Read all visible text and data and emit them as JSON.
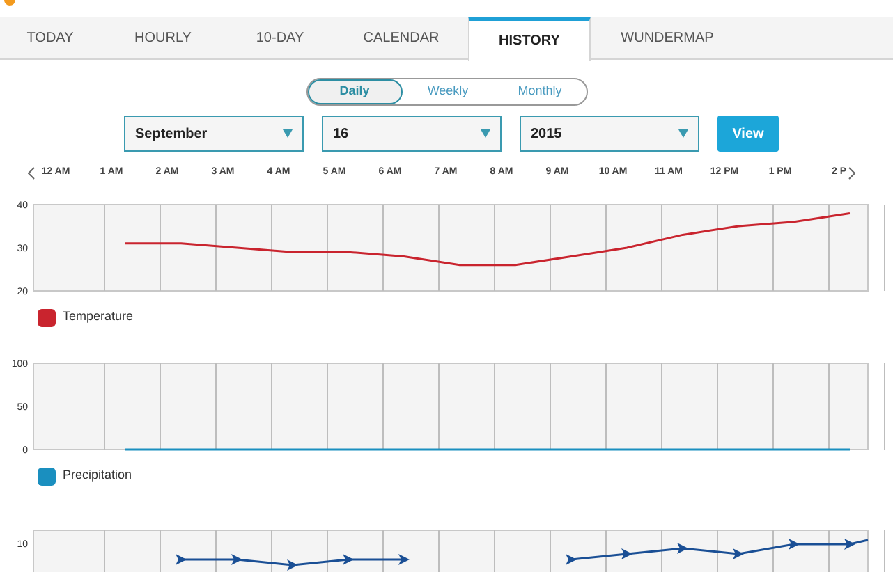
{
  "tabs": [
    {
      "label": "TODAY",
      "selected": false
    },
    {
      "label": "HOURLY",
      "selected": false
    },
    {
      "label": "10-DAY",
      "selected": false
    },
    {
      "label": "CALENDAR",
      "selected": false
    },
    {
      "label": "HISTORY",
      "selected": true
    },
    {
      "label": "WUNDERMAP",
      "selected": false
    }
  ],
  "period_toggle": [
    {
      "label": "Daily",
      "selected": true
    },
    {
      "label": "Weekly",
      "selected": false
    },
    {
      "label": "Monthly",
      "selected": false
    }
  ],
  "date_selects": [
    {
      "value": "September"
    },
    {
      "value": "16"
    },
    {
      "value": "2015"
    }
  ],
  "view_button": "View",
  "temperature_chart": {
    "chart_data": {
      "type": "line",
      "categories": [
        "12 AM",
        "1 AM",
        "2 AM",
        "3 AM",
        "4 AM",
        "5 AM",
        "6 AM",
        "7 AM",
        "8 AM",
        "9 AM",
        "10 AM",
        "11 AM",
        "12 PM",
        "1 PM",
        "2 P"
      ],
      "series": [
        {
          "name": "Temperature",
          "color": "#c9242e",
          "values": [
            null,
            31,
            31,
            30,
            29,
            29,
            28,
            26,
            26,
            28,
            30,
            33,
            35,
            36,
            38
          ]
        }
      ],
      "ylim": [
        20,
        40
      ],
      "yticks": [
        {
          "value": 20,
          "label": "20"
        },
        {
          "value": 30,
          "label": "30"
        },
        {
          "value": 40,
          "label": "40"
        }
      ]
    }
  },
  "precipitation_chart": {
    "chart_data": {
      "type": "line",
      "series": [
        {
          "name": "Precipitation",
          "color": "#1a8fbf",
          "values": [
            null,
            0,
            0,
            0,
            0,
            0,
            0,
            0,
            0,
            0,
            0,
            0,
            0,
            0,
            0
          ]
        }
      ],
      "ylim": [
        0,
        100
      ],
      "yticks": [
        {
          "value": 0,
          "label": "0"
        },
        {
          "value": 50,
          "label": "50"
        },
        {
          "value": 100,
          "label": "100"
        }
      ]
    }
  },
  "wind_chart": {
    "ytick": "10"
  }
}
